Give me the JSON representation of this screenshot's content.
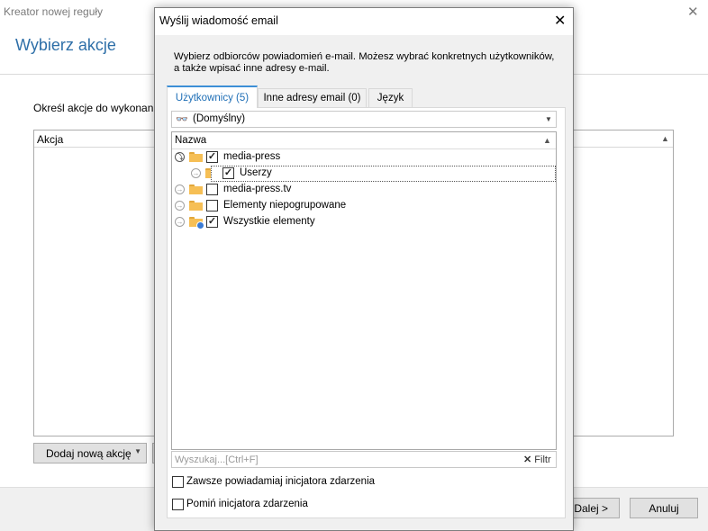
{
  "background_window": {
    "title": "Kreator nowej reguły",
    "heading": "Wybierz akcje",
    "instruction": "Określ akcje do wykonania. N",
    "table_column": "Akcja",
    "add_button": "Dodaj nową akcję",
    "next_button": "Dalej >",
    "cancel_button": "Anuluj"
  },
  "dialog": {
    "title": "Wyślij wiadomość email",
    "description": "Wybierz odbiorców powiadomień e-mail. Możesz wybrać konkretnych użytkowników, a także wpisać inne adresy e-mail.",
    "tabs": [
      {
        "label": "Użytkownicy (5)",
        "active": true
      },
      {
        "label": "Inne adresy email (0)",
        "active": false
      },
      {
        "label": "Język",
        "active": false
      }
    ],
    "view_select": {
      "value": "(Domyślny)"
    },
    "tree": {
      "column": "Nazwa",
      "rows": [
        {
          "label": "media-press",
          "checked": true,
          "expanded": true,
          "level": 0
        },
        {
          "label": "Userzy",
          "checked": true,
          "expanded": false,
          "level": 1,
          "selected": true
        },
        {
          "label": "media-press.tv",
          "checked": false,
          "expanded": false,
          "level": 0
        },
        {
          "label": "Elementy niepogrupowane",
          "checked": false,
          "expanded": false,
          "level": 0
        },
        {
          "label": "Wszystkie elementy",
          "checked": true,
          "expanded": false,
          "level": 0
        }
      ]
    },
    "search": {
      "placeholder": "Wyszukaj...[Ctrl+F]",
      "filter_label": "Filtr"
    },
    "options": [
      {
        "label": "Zawsze powiadamiaj inicjatora zdarzenia",
        "checked": false
      },
      {
        "label": "Pomiń inicjatora zdarzenia",
        "checked": false
      }
    ]
  },
  "colors": {
    "accent": "#2e6fa8",
    "tab_active": "#1f6fb6",
    "folder": "#f6bf55"
  }
}
